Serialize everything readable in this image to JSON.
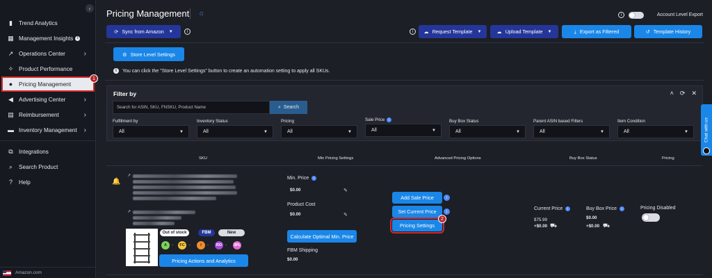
{
  "sidebar": {
    "items": [
      {
        "label": "Trend Analytics",
        "icon": "bar-chart-icon"
      },
      {
        "label": "Management Insights",
        "icon": "insights-icon",
        "info": "i"
      },
      {
        "label": "Operations Center",
        "icon": "trend-up-icon",
        "chevron": "›"
      },
      {
        "label": "Product Performance",
        "icon": "sparkle-icon"
      },
      {
        "label": "Pricing Management",
        "icon": "tag-icon",
        "active": true
      },
      {
        "label": "Advertising Center",
        "icon": "megaphone-icon",
        "chevron": "›"
      },
      {
        "label": "Reimbursement",
        "icon": "reimbursement-icon",
        "chevron": "›"
      },
      {
        "label": "Inventory Management",
        "icon": "inventory-icon",
        "chevron": "›"
      },
      {
        "label": "Integrations",
        "icon": "integrations-icon"
      },
      {
        "label": "Search Product",
        "icon": "search-icon"
      },
      {
        "label": "Help",
        "icon": "help-icon"
      }
    ],
    "collapse": "‹",
    "marketplace": "Amazon.com"
  },
  "header": {
    "title": "Pricing Management",
    "account_level_export": "Account Level Export"
  },
  "toolbar": {
    "sync": "Sync from Amazon",
    "request_template": "Request Template",
    "upload_template": "Upload Template",
    "export_filtered": "Export as Filtered",
    "template_history": "Template History",
    "store_level": "Store Level Settings"
  },
  "notice": "You can click the \"Store Level Settings\" button to create an automation setting to apply all SKUs.",
  "filter": {
    "title": "Filter by",
    "search_placeholder": "Search for ASIN, SKU, FNSKU, Product Name",
    "search_button": "Search",
    "fields": [
      {
        "label": "Fulfillment by",
        "value": "All"
      },
      {
        "label": "Inventory Status",
        "value": "All"
      },
      {
        "label": "Pricing",
        "value": "All"
      },
      {
        "label": "Sale Price",
        "value": "All",
        "info": true
      },
      {
        "label": "Buy Box Status",
        "value": "All"
      },
      {
        "label": "Parent ASIN based Filters",
        "value": "All"
      },
      {
        "label": "Item Condition",
        "value": "All"
      }
    ]
  },
  "table": {
    "headers": [
      "SKU",
      "Min Pricing Settings",
      "Advanced Pricing Options",
      "Buy Box Status",
      "Pricing"
    ]
  },
  "row": {
    "stock": "Out of stock",
    "fulfillment": "FBM",
    "condition": "New",
    "status_dots": [
      "A",
      "FC",
      "I",
      "RO",
      "3PL"
    ],
    "pricing_actions": "Pricing Actions and Analytics",
    "min_price_label": "Min. Price",
    "min_price": "$0.00",
    "product_cost_label": "Product Cost",
    "product_cost": "$0.00",
    "calc_min": "Calculate Optimal Min. Price",
    "fbm_shipping_label": "FBM Shipping",
    "fbm_shipping": "$0.00",
    "add_sale_price": "Add Sale Price",
    "set_current_price": "Set Current Price",
    "pricing_settings": "Pricing Settings",
    "current_price_label": "Current Price",
    "current_price": "$75.99",
    "current_ship": "+$0.00",
    "buybox_label": "Buy Box Price",
    "buybox_price": "$0.00",
    "buybox_ship": "+$0.00",
    "pricing_disabled": "Pricing Disabled"
  },
  "callouts": {
    "one": "1",
    "two": "2"
  },
  "chat": "Chat with us"
}
